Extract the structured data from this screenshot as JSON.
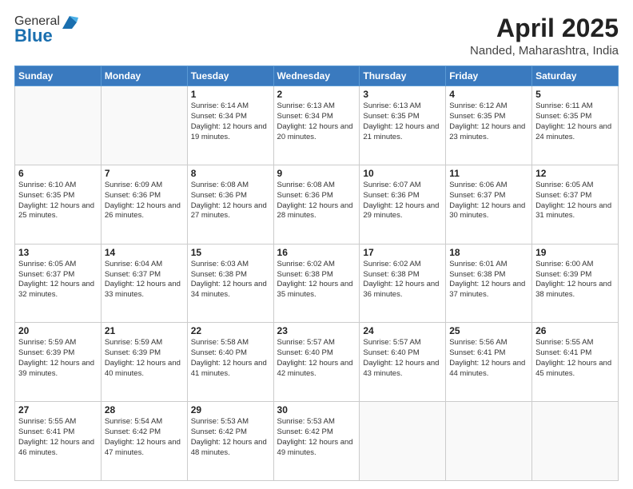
{
  "header": {
    "logo_general": "General",
    "logo_blue": "Blue",
    "month": "April 2025",
    "location": "Nanded, Maharashtra, India"
  },
  "weekdays": [
    "Sunday",
    "Monday",
    "Tuesday",
    "Wednesday",
    "Thursday",
    "Friday",
    "Saturday"
  ],
  "weeks": [
    [
      {
        "day": "",
        "info": ""
      },
      {
        "day": "",
        "info": ""
      },
      {
        "day": "1",
        "info": "Sunrise: 6:14 AM\nSunset: 6:34 PM\nDaylight: 12 hours and 19 minutes."
      },
      {
        "day": "2",
        "info": "Sunrise: 6:13 AM\nSunset: 6:34 PM\nDaylight: 12 hours and 20 minutes."
      },
      {
        "day": "3",
        "info": "Sunrise: 6:13 AM\nSunset: 6:35 PM\nDaylight: 12 hours and 21 minutes."
      },
      {
        "day": "4",
        "info": "Sunrise: 6:12 AM\nSunset: 6:35 PM\nDaylight: 12 hours and 23 minutes."
      },
      {
        "day": "5",
        "info": "Sunrise: 6:11 AM\nSunset: 6:35 PM\nDaylight: 12 hours and 24 minutes."
      }
    ],
    [
      {
        "day": "6",
        "info": "Sunrise: 6:10 AM\nSunset: 6:35 PM\nDaylight: 12 hours and 25 minutes."
      },
      {
        "day": "7",
        "info": "Sunrise: 6:09 AM\nSunset: 6:36 PM\nDaylight: 12 hours and 26 minutes."
      },
      {
        "day": "8",
        "info": "Sunrise: 6:08 AM\nSunset: 6:36 PM\nDaylight: 12 hours and 27 minutes."
      },
      {
        "day": "9",
        "info": "Sunrise: 6:08 AM\nSunset: 6:36 PM\nDaylight: 12 hours and 28 minutes."
      },
      {
        "day": "10",
        "info": "Sunrise: 6:07 AM\nSunset: 6:36 PM\nDaylight: 12 hours and 29 minutes."
      },
      {
        "day": "11",
        "info": "Sunrise: 6:06 AM\nSunset: 6:37 PM\nDaylight: 12 hours and 30 minutes."
      },
      {
        "day": "12",
        "info": "Sunrise: 6:05 AM\nSunset: 6:37 PM\nDaylight: 12 hours and 31 minutes."
      }
    ],
    [
      {
        "day": "13",
        "info": "Sunrise: 6:05 AM\nSunset: 6:37 PM\nDaylight: 12 hours and 32 minutes."
      },
      {
        "day": "14",
        "info": "Sunrise: 6:04 AM\nSunset: 6:37 PM\nDaylight: 12 hours and 33 minutes."
      },
      {
        "day": "15",
        "info": "Sunrise: 6:03 AM\nSunset: 6:38 PM\nDaylight: 12 hours and 34 minutes."
      },
      {
        "day": "16",
        "info": "Sunrise: 6:02 AM\nSunset: 6:38 PM\nDaylight: 12 hours and 35 minutes."
      },
      {
        "day": "17",
        "info": "Sunrise: 6:02 AM\nSunset: 6:38 PM\nDaylight: 12 hours and 36 minutes."
      },
      {
        "day": "18",
        "info": "Sunrise: 6:01 AM\nSunset: 6:38 PM\nDaylight: 12 hours and 37 minutes."
      },
      {
        "day": "19",
        "info": "Sunrise: 6:00 AM\nSunset: 6:39 PM\nDaylight: 12 hours and 38 minutes."
      }
    ],
    [
      {
        "day": "20",
        "info": "Sunrise: 5:59 AM\nSunset: 6:39 PM\nDaylight: 12 hours and 39 minutes."
      },
      {
        "day": "21",
        "info": "Sunrise: 5:59 AM\nSunset: 6:39 PM\nDaylight: 12 hours and 40 minutes."
      },
      {
        "day": "22",
        "info": "Sunrise: 5:58 AM\nSunset: 6:40 PM\nDaylight: 12 hours and 41 minutes."
      },
      {
        "day": "23",
        "info": "Sunrise: 5:57 AM\nSunset: 6:40 PM\nDaylight: 12 hours and 42 minutes."
      },
      {
        "day": "24",
        "info": "Sunrise: 5:57 AM\nSunset: 6:40 PM\nDaylight: 12 hours and 43 minutes."
      },
      {
        "day": "25",
        "info": "Sunrise: 5:56 AM\nSunset: 6:41 PM\nDaylight: 12 hours and 44 minutes."
      },
      {
        "day": "26",
        "info": "Sunrise: 5:55 AM\nSunset: 6:41 PM\nDaylight: 12 hours and 45 minutes."
      }
    ],
    [
      {
        "day": "27",
        "info": "Sunrise: 5:55 AM\nSunset: 6:41 PM\nDaylight: 12 hours and 46 minutes."
      },
      {
        "day": "28",
        "info": "Sunrise: 5:54 AM\nSunset: 6:42 PM\nDaylight: 12 hours and 47 minutes."
      },
      {
        "day": "29",
        "info": "Sunrise: 5:53 AM\nSunset: 6:42 PM\nDaylight: 12 hours and 48 minutes."
      },
      {
        "day": "30",
        "info": "Sunrise: 5:53 AM\nSunset: 6:42 PM\nDaylight: 12 hours and 49 minutes."
      },
      {
        "day": "",
        "info": ""
      },
      {
        "day": "",
        "info": ""
      },
      {
        "day": "",
        "info": ""
      }
    ]
  ]
}
